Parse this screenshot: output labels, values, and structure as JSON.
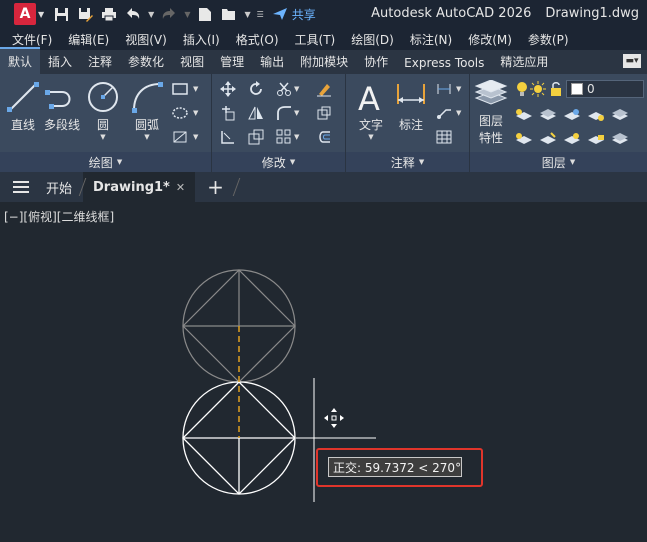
{
  "title_bar": {
    "logo_letter": "A",
    "share_label": "共享",
    "app_name": "Autodesk AutoCAD 2026",
    "document_name": "Drawing1.dwg"
  },
  "menu": [
    "文件(F)",
    "编辑(E)",
    "视图(V)",
    "插入(I)",
    "格式(O)",
    "工具(T)",
    "绘图(D)",
    "标注(N)",
    "修改(M)",
    "参数(P)"
  ],
  "ribbon_tabs": [
    "默认",
    "插入",
    "注释",
    "参数化",
    "视图",
    "管理",
    "输出",
    "附加模块",
    "协作",
    "Express Tools",
    "精选应用"
  ],
  "ribbon_active_tab": "默认",
  "ribbon": {
    "draw_panel": {
      "title": "绘图",
      "line_label": "直线",
      "polyline_label": "多段线",
      "circle_label": "圆",
      "arc_label": "圆弧"
    },
    "modify_panel": {
      "title": "修改"
    },
    "annotation_panel": {
      "title": "注释",
      "text_label": "文字",
      "dimension_label": "标注"
    },
    "layers_panel": {
      "title": "图层",
      "layer_properties_label_1": "图层",
      "layer_properties_label_2": "特性",
      "current_layer": "0"
    }
  },
  "file_tabs": {
    "start_label": "开始",
    "active_label": "Drawing1*"
  },
  "viewport_label": "[−][俯视][二维线框]",
  "ortho_tooltip": "正交: 59.7372 < 270°",
  "colors": {
    "canvas_bg": "#212830",
    "geometry_upper": "#8a8a8a",
    "geometry_lower": "#ffffff",
    "tracking_line": "#e0a020",
    "highlight_frame": "#e0352b",
    "share_blue": "#6cb4ff"
  }
}
